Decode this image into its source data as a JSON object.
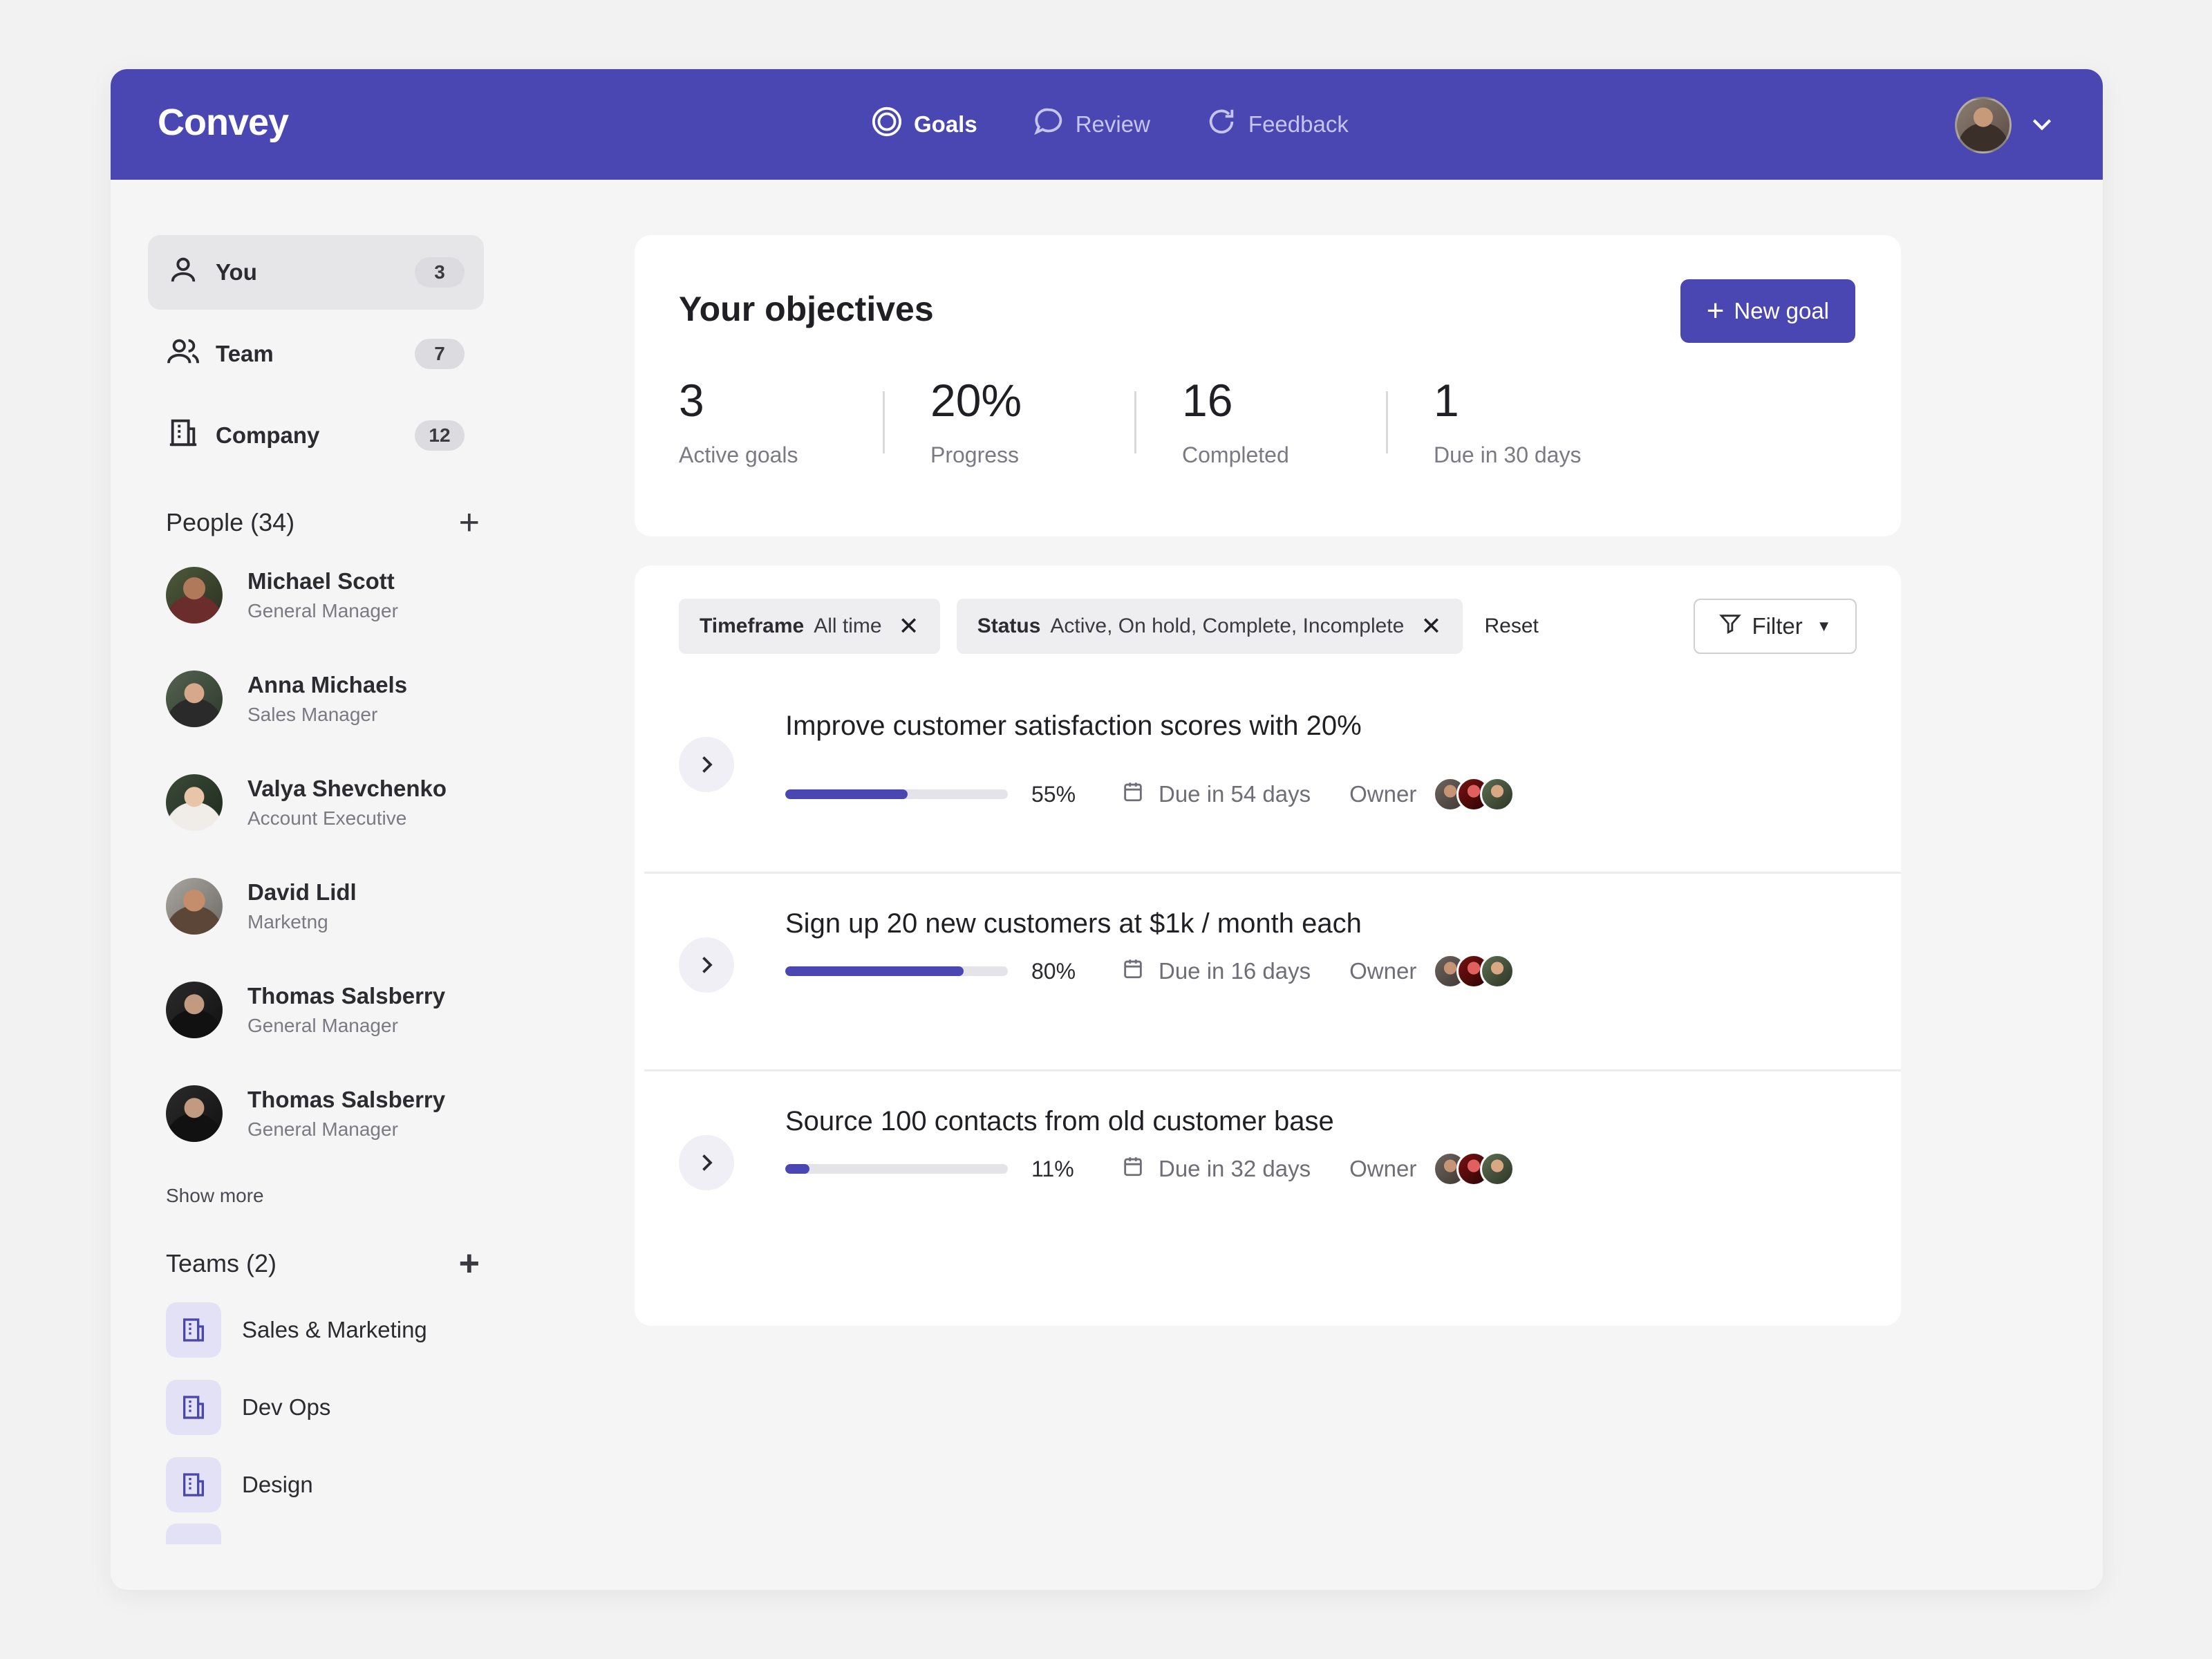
{
  "app": {
    "logo": "Convey"
  },
  "nav": {
    "items": [
      {
        "label": "Goals",
        "icon": "target-icon",
        "active": true
      },
      {
        "label": "Review",
        "icon": "chat-bubble-icon",
        "active": false
      },
      {
        "label": "Feedback",
        "icon": "refresh-icon",
        "active": false
      }
    ]
  },
  "scopes": [
    {
      "label": "You",
      "count": "3",
      "icon": "user-icon",
      "active": true
    },
    {
      "label": "Team",
      "count": "7",
      "icon": "users-icon",
      "active": false
    },
    {
      "label": "Company",
      "count": "12",
      "icon": "building-icon",
      "active": false
    }
  ],
  "people": {
    "heading": "People (34)",
    "items": [
      {
        "name": "Michael Scott",
        "role": "General Manager"
      },
      {
        "name": "Anna Michaels",
        "role": "Sales Manager"
      },
      {
        "name": "Valya Shevchenko",
        "role": "Account Executive"
      },
      {
        "name": "David Lidl",
        "role": "Marketng"
      },
      {
        "name": "Thomas Salsberry",
        "role": "General Manager"
      },
      {
        "name": "Thomas Salsberry",
        "role": "General Manager"
      }
    ],
    "show_more": "Show more"
  },
  "teams": {
    "heading": "Teams (2)",
    "items": [
      "Sales & Marketing",
      "Dev Ops",
      "Design"
    ]
  },
  "objectives": {
    "title": "Your objectives",
    "new_goal_label": "New goal",
    "stats": [
      {
        "value": "3",
        "label": "Active goals"
      },
      {
        "value": "20%",
        "label": "Progress"
      },
      {
        "value": "16",
        "label": "Completed"
      },
      {
        "value": "1",
        "label": "Due in 30 days"
      }
    ]
  },
  "filters": {
    "chips": [
      {
        "key": "Timeframe",
        "value": "All time"
      },
      {
        "key": "Status",
        "value": "Active, On hold, Complete, Incomplete"
      }
    ],
    "reset_label": "Reset",
    "filter_label": "Filter"
  },
  "goals": [
    {
      "title": "Improve customer satisfaction scores with 20%",
      "progress": 0.55,
      "progress_label": "55%",
      "due": "Due in 54 days",
      "owner_label": "Owner"
    },
    {
      "title": "Sign up 20 new customers at $1k / month each",
      "progress": 0.8,
      "progress_label": "80%",
      "due": "Due in 16 days",
      "owner_label": "Owner"
    },
    {
      "title": "Source 100 contacts from old customer base",
      "progress": 0.11,
      "progress_label": "11%",
      "due": "Due in 32 days",
      "owner_label": "Owner"
    }
  ],
  "colors": {
    "brand": "#4a47b2",
    "background": "#f5f5f6"
  }
}
